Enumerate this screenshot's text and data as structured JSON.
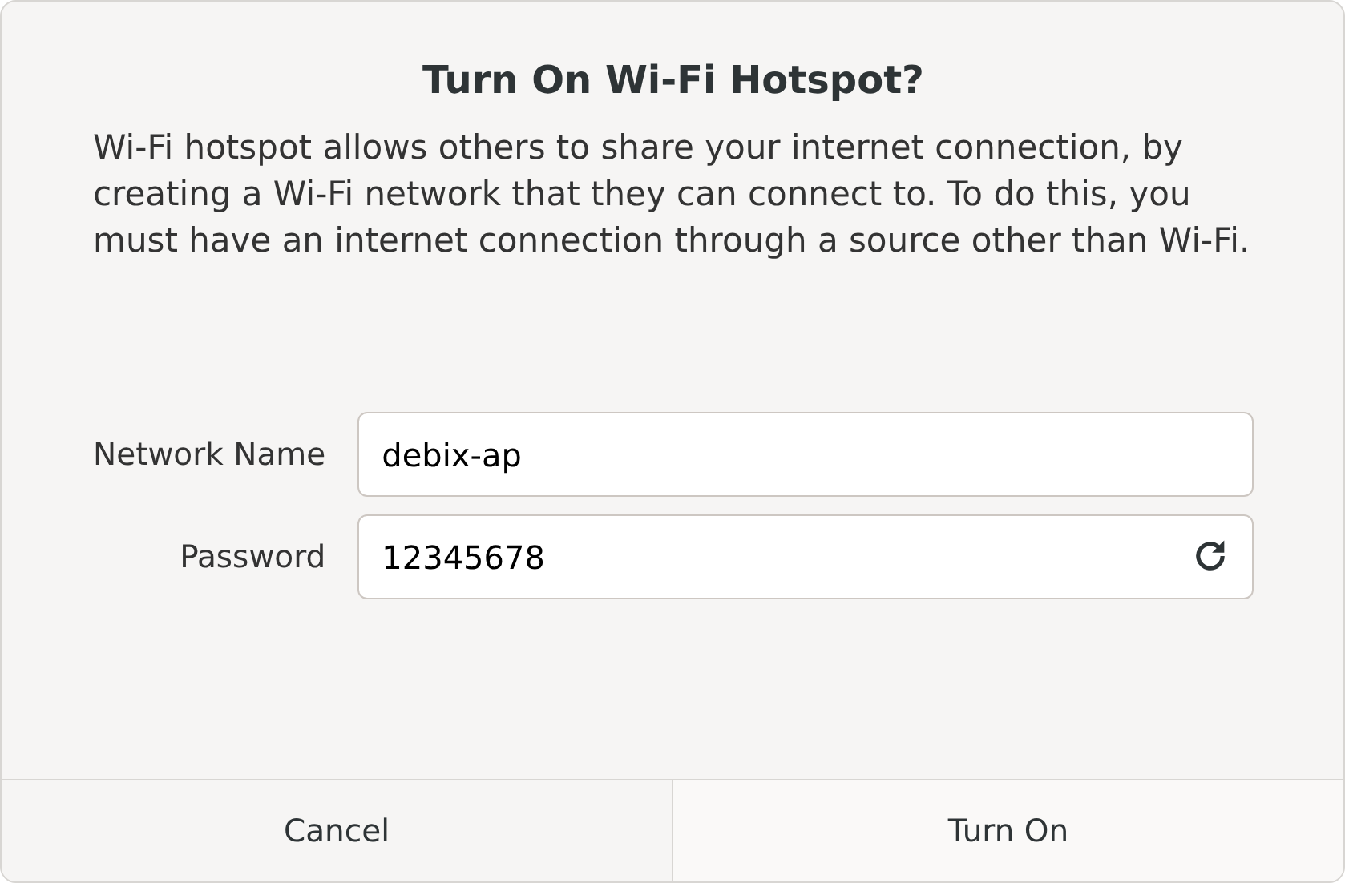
{
  "dialog": {
    "title": "Turn On Wi-Fi Hotspot?",
    "description": "Wi-Fi hotspot allows others to share your internet connection, by creating a Wi-Fi network that they can connect to. To do this, you must have an internet connection through a source other than Wi-Fi.",
    "fields": [
      {
        "label": "Network Name",
        "value": "debix-ap",
        "kind": "text"
      },
      {
        "label": "Password",
        "value": "12345678",
        "kind": "password"
      }
    ],
    "buttons": [
      {
        "label": "Cancel"
      },
      {
        "label": "Turn On"
      }
    ]
  }
}
